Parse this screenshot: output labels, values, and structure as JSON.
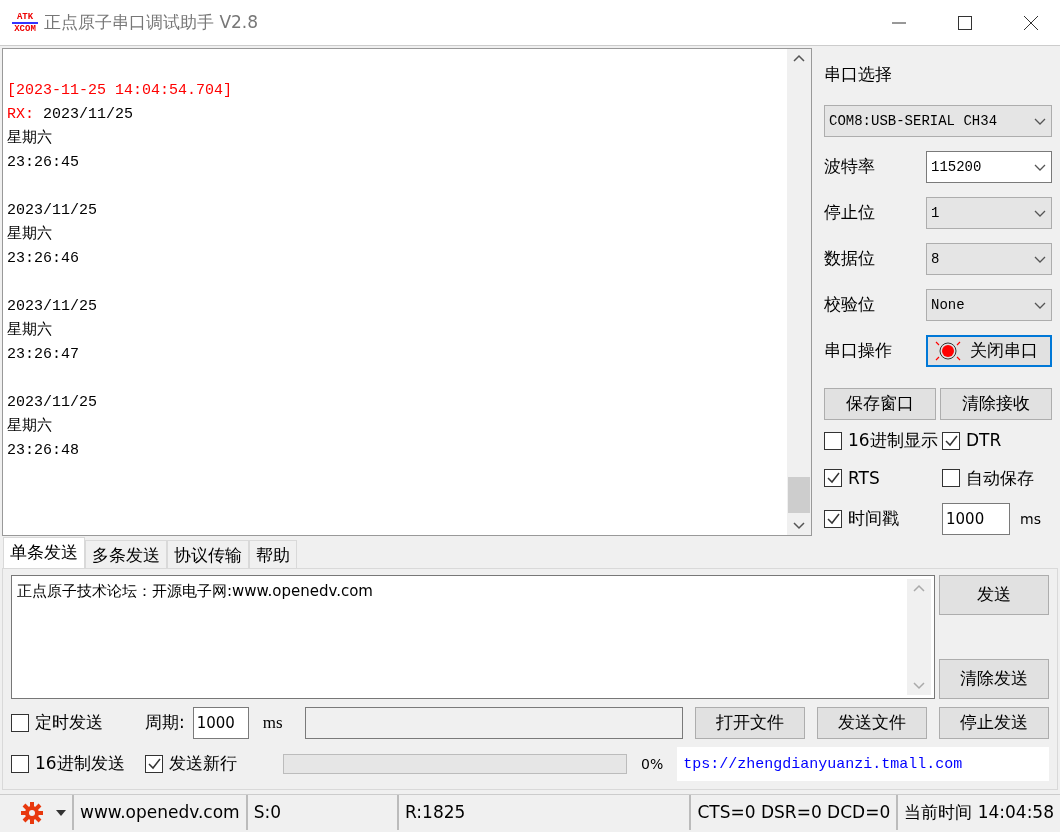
{
  "window": {
    "title": "正点原子串口调试助手 V2.8",
    "logo": [
      "ATK",
      "XCOM"
    ]
  },
  "receive": {
    "lines": [
      {
        "kind": "blank"
      },
      {
        "kind": "timestamp",
        "text": "[2023-11-25 14:04:54.704]"
      },
      {
        "kind": "rx",
        "prefix": "RX:",
        "text": "2023/11/25"
      },
      {
        "kind": "plain",
        "text": "星期六"
      },
      {
        "kind": "plain",
        "text": "23:26:45"
      },
      {
        "kind": "blank"
      },
      {
        "kind": "plain",
        "text": "2023/11/25"
      },
      {
        "kind": "plain",
        "text": "星期六"
      },
      {
        "kind": "plain",
        "text": "23:26:46"
      },
      {
        "kind": "blank"
      },
      {
        "kind": "plain",
        "text": "2023/11/25"
      },
      {
        "kind": "plain",
        "text": "星期六"
      },
      {
        "kind": "plain",
        "text": "23:26:47"
      },
      {
        "kind": "blank"
      },
      {
        "kind": "plain",
        "text": "2023/11/25"
      },
      {
        "kind": "plain",
        "text": "星期六"
      },
      {
        "kind": "plain",
        "text": "23:26:48"
      }
    ]
  },
  "port": {
    "label": "串口选择",
    "value": "COM8:USB-SERIAL CH34"
  },
  "settings": [
    {
      "label": "波特率",
      "value": "115200",
      "kind": "editable"
    },
    {
      "label": "停止位",
      "value": "1",
      "kind": "list"
    },
    {
      "label": "数据位",
      "value": "8",
      "kind": "list"
    },
    {
      "label": "校验位",
      "value": "None",
      "kind": "list"
    }
  ],
  "operation": {
    "label": "串口操作",
    "button": "关闭串口",
    "open": true
  },
  "receive_buttons": [
    "保存窗口",
    "清除接收"
  ],
  "options": [
    {
      "label": "16进制显示",
      "checked": false
    },
    {
      "label": "DTR",
      "checked": true
    },
    {
      "label": "RTS",
      "checked": true
    },
    {
      "label": "自动保存",
      "checked": false
    },
    {
      "label": "时间戳",
      "checked": true
    }
  ],
  "timestamp_interval": {
    "value": "1000",
    "unit": "ms"
  },
  "tabs": [
    {
      "label": "单条发送",
      "selected": true
    },
    {
      "label": "多条发送",
      "selected": false
    },
    {
      "label": "协议传输",
      "selected": false
    },
    {
      "label": "帮助",
      "selected": false
    }
  ],
  "send": {
    "text": "正点原子技术论坛：开源电子网:www.openedv.com",
    "buttons": [
      "发送",
      "清除发送"
    ]
  },
  "timer": {
    "label": "定时发送",
    "checked": false,
    "period_label": "周期:",
    "period": "1000",
    "unit": "ms"
  },
  "file_buttons": [
    "打开文件",
    "发送文件",
    "停止发送"
  ],
  "send_options": [
    {
      "label": "16进制发送",
      "checked": false
    },
    {
      "label": "发送新行",
      "checked": true
    }
  ],
  "progress": {
    "level": 0,
    "reading": "0%"
  },
  "link": "tps://zhengdianyuanzi.tmall.com",
  "status_bar": [
    "www.openedv.com",
    "S:0",
    "R:1825",
    "CTS=0 DSR=0 DCD=0",
    "当前时间 14:04:58"
  ]
}
